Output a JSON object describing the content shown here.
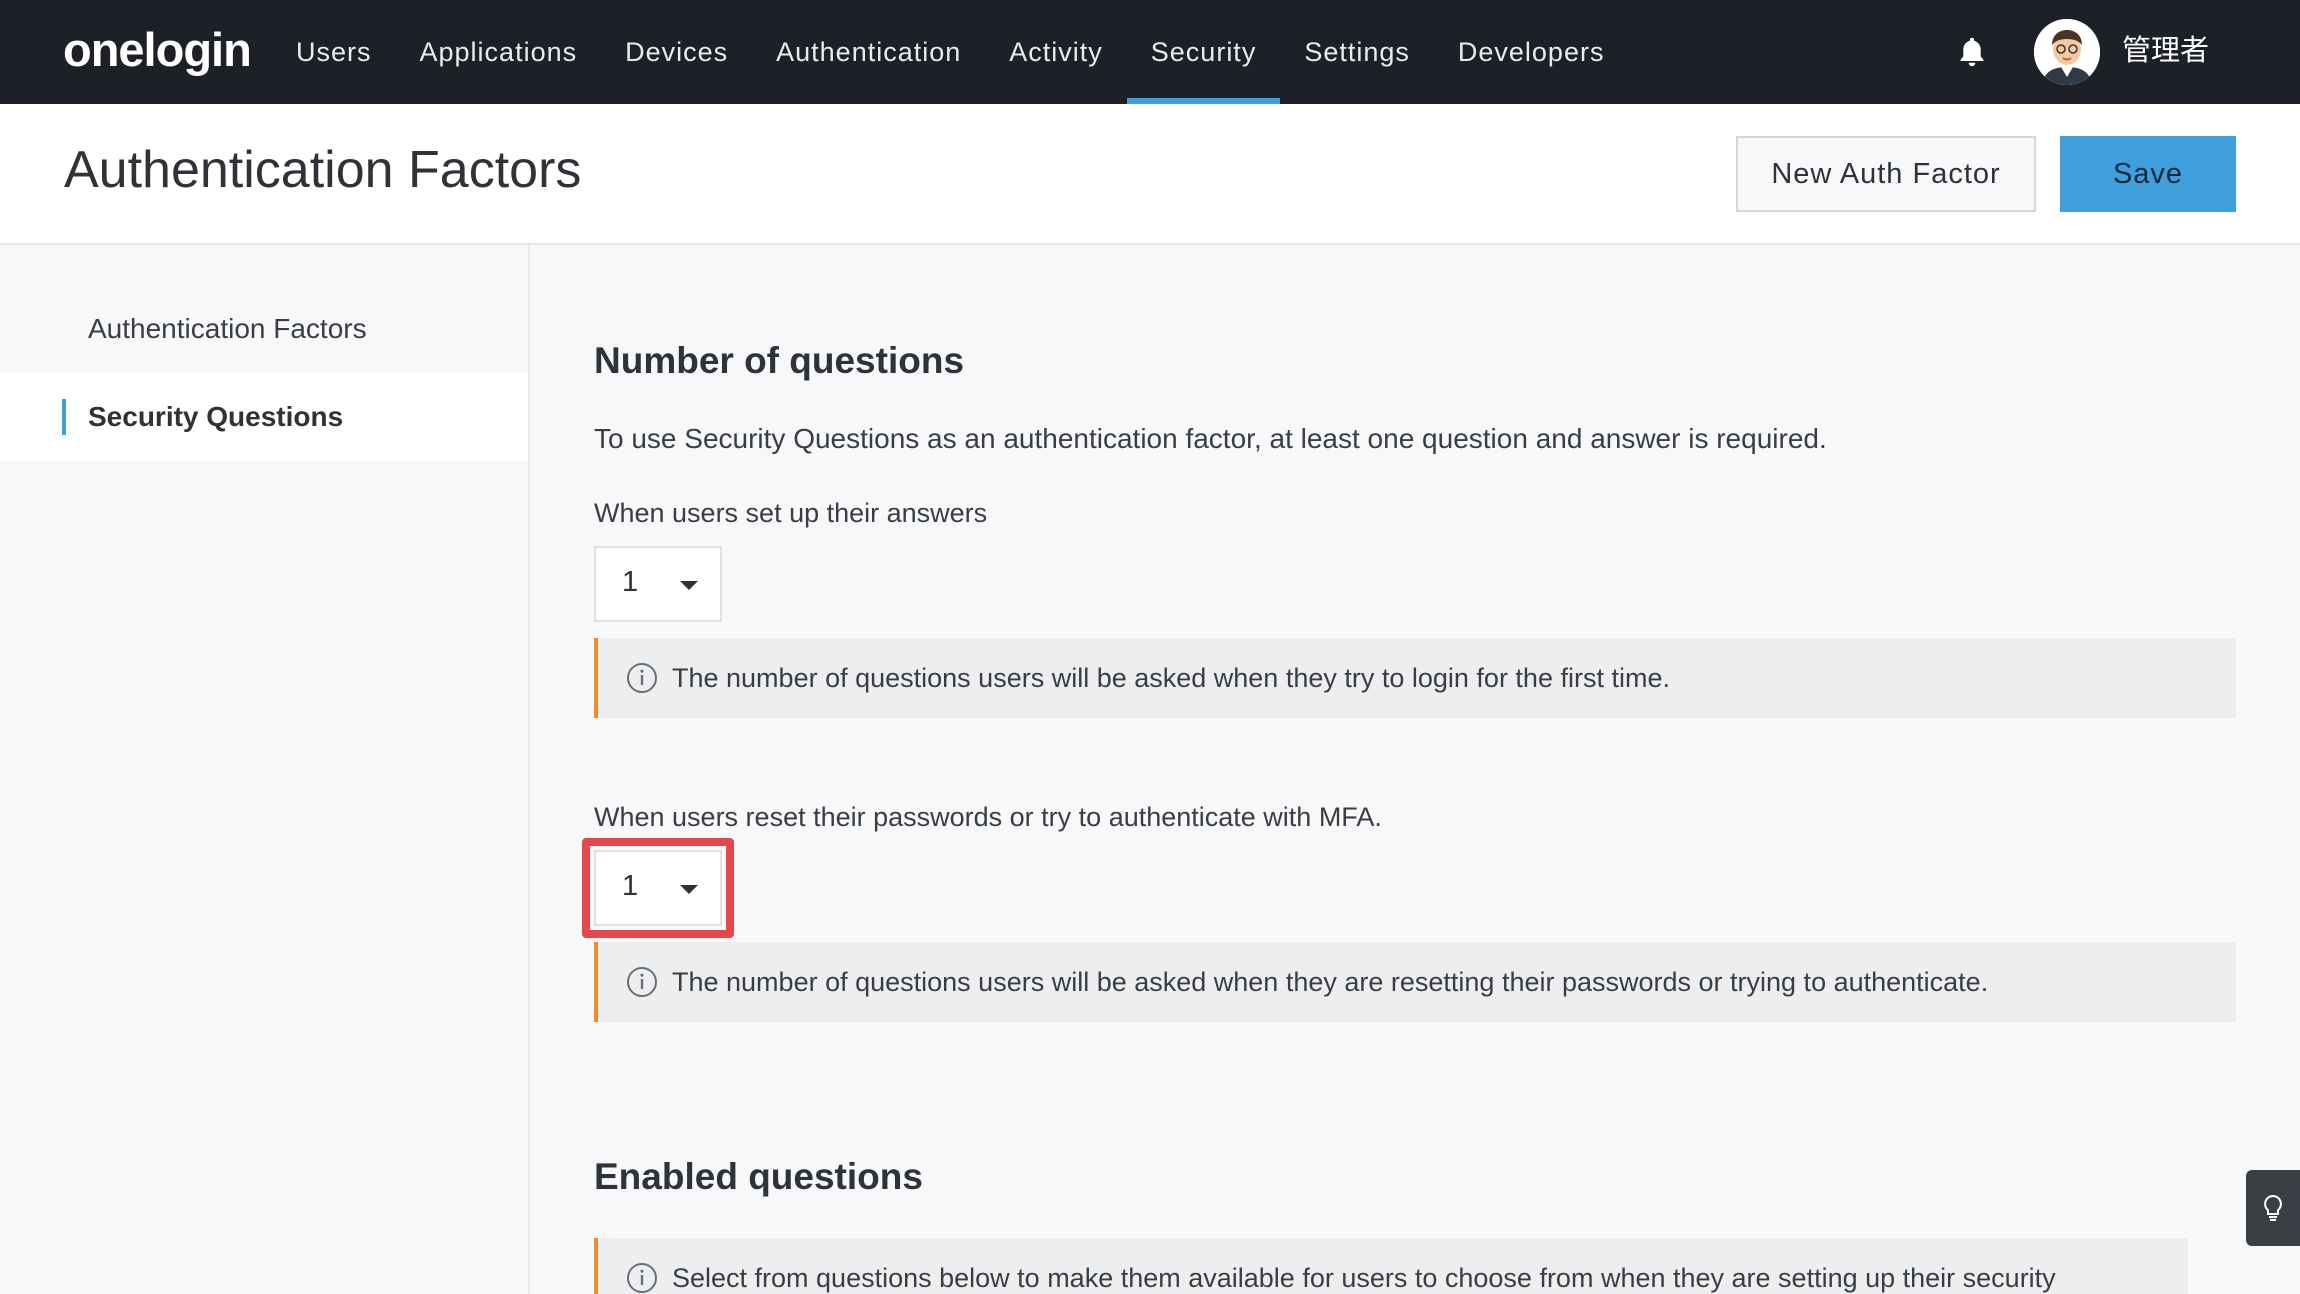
{
  "nav": {
    "logo": "onelogin",
    "items": [
      {
        "label": "Users"
      },
      {
        "label": "Applications"
      },
      {
        "label": "Devices"
      },
      {
        "label": "Authentication"
      },
      {
        "label": "Activity"
      },
      {
        "label": "Security",
        "active": true
      },
      {
        "label": "Settings"
      },
      {
        "label": "Developers"
      }
    ],
    "user_name": "管理者",
    "bell_icon": "bell-icon",
    "accent_color": "#3f9fdc"
  },
  "header": {
    "title": "Authentication Factors",
    "new_button": "New Auth Factor",
    "save_button": "Save"
  },
  "sidebar": {
    "items": [
      {
        "label": "Authentication Factors"
      },
      {
        "label": "Security Questions",
        "active": true
      }
    ]
  },
  "main": {
    "number_section": {
      "title": "Number of questions",
      "description": "To use Security Questions as an authentication factor, at least one question and answer is required.",
      "setup": {
        "label": "When users set up their answers",
        "value": "1",
        "info": "The number of questions users will be asked when they try to login for the first time."
      },
      "reset": {
        "label": "When users reset their passwords or try to authenticate with MFA.",
        "value": "1",
        "info": "The number of questions users will be asked when they are resetting their passwords or trying to authenticate."
      }
    },
    "enabled_section": {
      "title": "Enabled questions",
      "info": "Select from questions below to make them available for users to choose from when they are setting up their security"
    }
  }
}
